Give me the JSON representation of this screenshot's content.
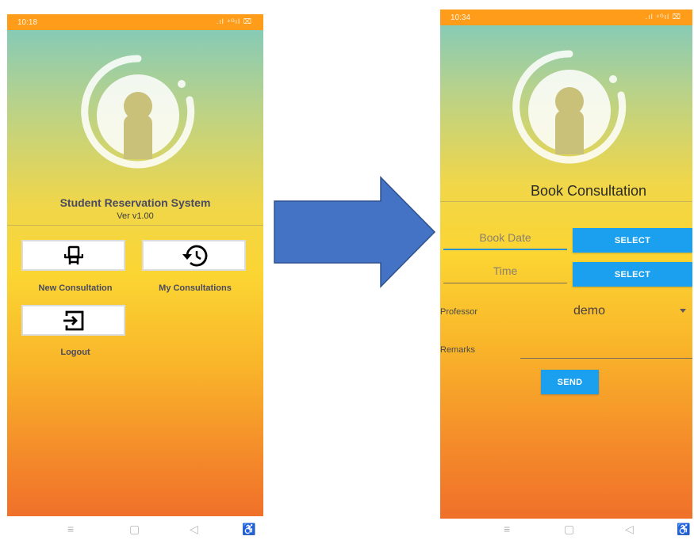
{
  "left_screen": {
    "status": {
      "time": "10:18",
      "icons": ".ıl ⁴ᴳıl ⌧"
    },
    "app_title": "Student Reservation System",
    "version": "Ver v1.00",
    "tiles": [
      {
        "label": "New Consultation",
        "icon": "chair-icon"
      },
      {
        "label": "My Consultations",
        "icon": "history-icon"
      },
      {
        "label": "Logout",
        "icon": "logout-icon"
      }
    ]
  },
  "right_screen": {
    "status": {
      "time": "10:34",
      "icons": ".ıl ⁴ᴳıl ⌧"
    },
    "title": "Book Consultation",
    "book_date_placeholder": "Book Date",
    "time_placeholder": "Time",
    "select_label": "SELECT",
    "professor_label": "Professor",
    "professor_value": "demo",
    "remarks_label": "Remarks",
    "send_label": "SEND"
  },
  "navbar": {
    "menu": "≡",
    "home": "▢",
    "back": "◁",
    "accessibility": "♿"
  },
  "colors": {
    "accent": "#1aa0ee",
    "arrow": "#4472c4",
    "status_bar": "#ff9c1a"
  }
}
